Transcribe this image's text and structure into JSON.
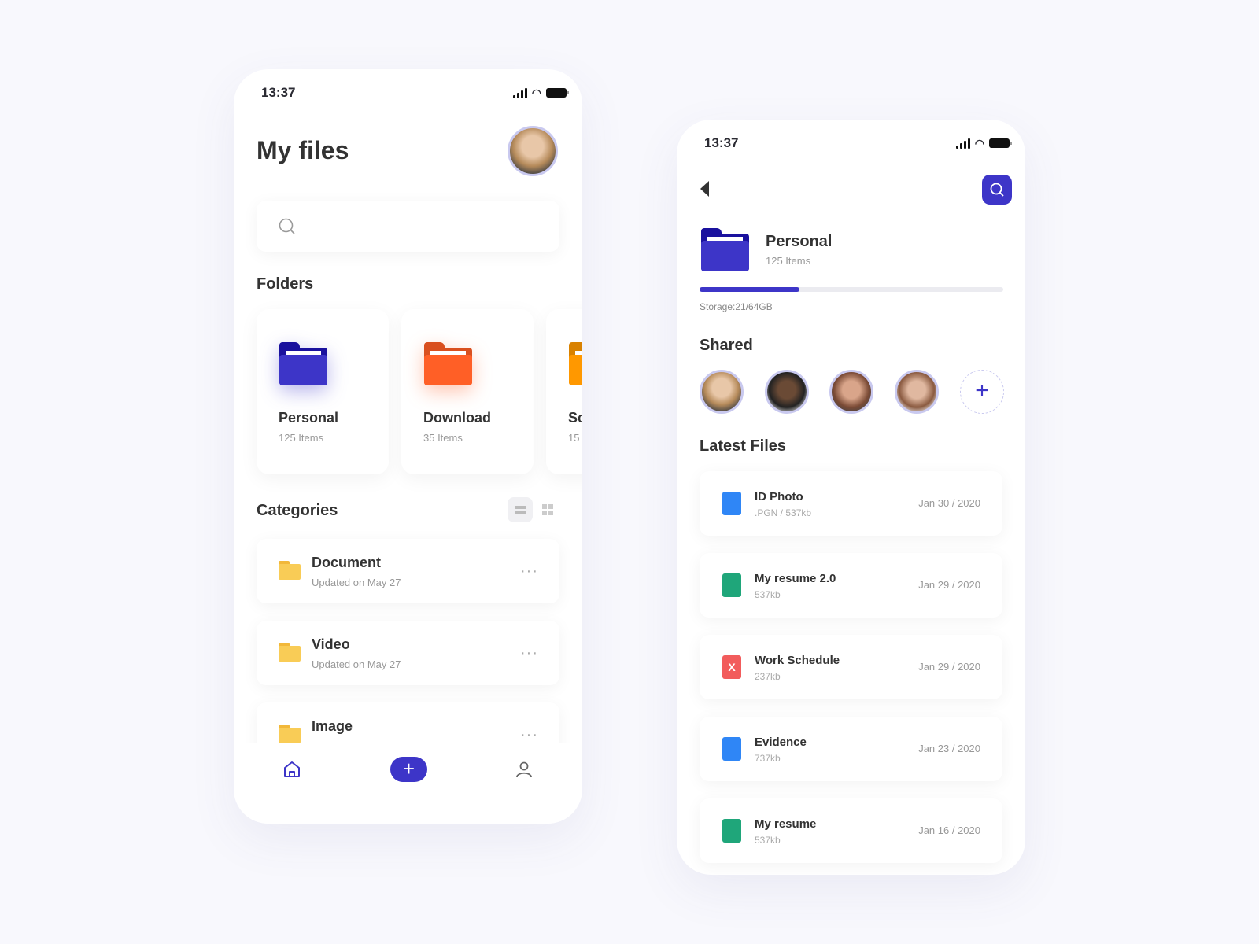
{
  "screen1": {
    "time": "13:37",
    "title": "My files",
    "search_placeholder": "",
    "folders_heading": "Folders",
    "folders": [
      {
        "name": "Personal",
        "count": "125 Items",
        "color": "#3d35c8"
      },
      {
        "name": "Download",
        "count": "35 Items",
        "color": "#ff5f26"
      },
      {
        "name": "Sc",
        "count": "15",
        "color": "#ff9800"
      }
    ],
    "categories_heading": "Categories",
    "categories": [
      {
        "name": "Document",
        "updated": "Updated on May 27"
      },
      {
        "name": "Video",
        "updated": "Updated on May 27"
      },
      {
        "name": "Image",
        "updated": ""
      }
    ],
    "nav": {
      "add": "+"
    }
  },
  "screen2": {
    "time": "13:37",
    "folder": {
      "name": "Personal",
      "count": "125 Items"
    },
    "storage": {
      "label": "Storage:21/64GB",
      "used": 21,
      "total": 64
    },
    "shared_heading": "Shared",
    "add_shared": "+",
    "latest_heading": "Latest Files",
    "files": [
      {
        "name": "ID Photo",
        "meta": ".PGN  /  537kb",
        "date": "Jan 30 / 2020",
        "type": "image"
      },
      {
        "name": "My resume 2.0",
        "meta": "537kb",
        "date": "Jan 29 / 2020",
        "type": "doc"
      },
      {
        "name": "Work Schedule",
        "meta": "237kb",
        "date": "Jan 29 / 2020",
        "type": "excel"
      },
      {
        "name": "Evidence",
        "meta": "737kb",
        "date": "Jan 23 / 2020",
        "type": "image"
      },
      {
        "name": "My resume",
        "meta": "537kb",
        "date": "Jan 16 / 2020",
        "type": "doc"
      }
    ]
  },
  "colors": {
    "accent": "#3d35c8",
    "image": "#2f86f6",
    "doc": "#1fa67a",
    "excel": "#f25c5c",
    "folder_yellow": "#f9cc56"
  }
}
